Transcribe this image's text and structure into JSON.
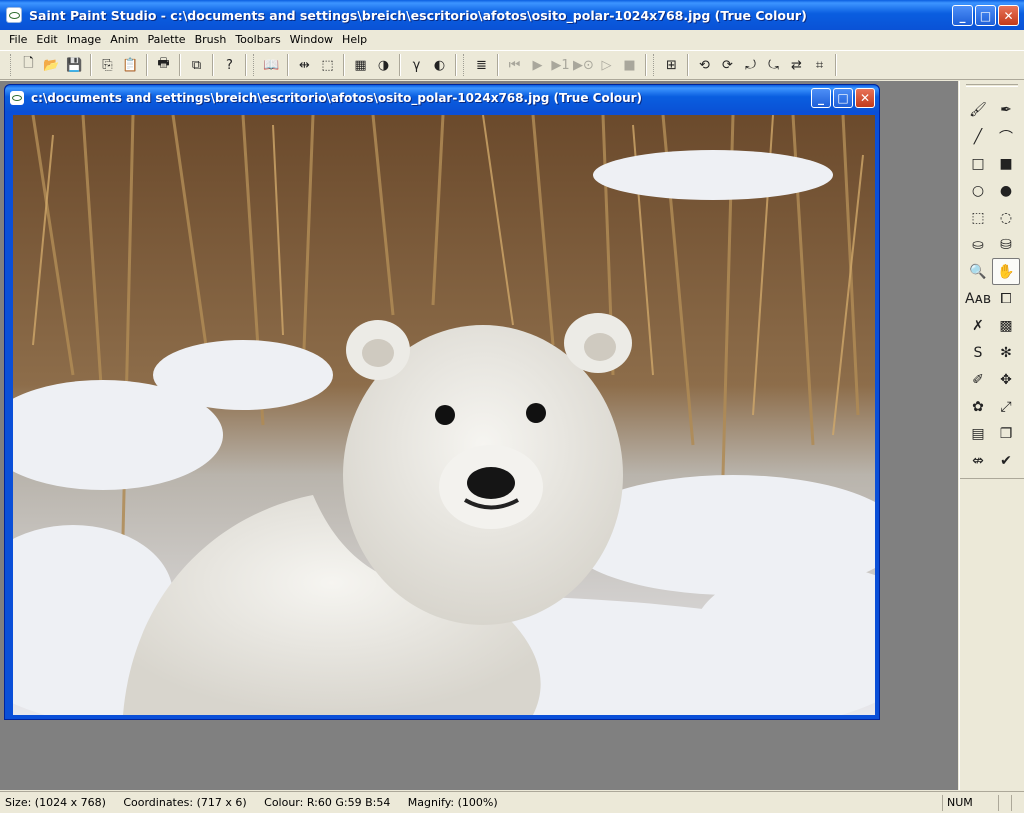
{
  "window": {
    "title": "Saint Paint Studio - c:\\documents and settings\\breich\\escritorio\\afotos\\osito_polar-1024x768.jpg (True Colour)",
    "buttons": {
      "minimize": "_",
      "maximize": "□",
      "close": "✕"
    }
  },
  "menu": [
    "File",
    "Edit",
    "Image",
    "Anim",
    "Palette",
    "Brush",
    "Toolbars",
    "Window",
    "Help"
  ],
  "toolbar": {
    "new": "🗋",
    "open": "📂",
    "save": "💾",
    "copy": "⎘",
    "paste": "📋",
    "print": "🖶",
    "duplicate": "⧉",
    "help": "?",
    "book": "📖",
    "resize": "⇹",
    "crop": "⬚",
    "palette": "▦",
    "contrast": "◑",
    "gamma": "γ",
    "invert": "◐",
    "stack": "≣",
    "anim_first": "⏮",
    "anim_play": "▶",
    "anim_step": "▶1",
    "anim_next": "▶⊙",
    "anim_loop": "▷",
    "anim_stop": "■",
    "view": "⊞",
    "rot_left": "⟲",
    "rot_right": "⟳",
    "rot_a": "⤾",
    "rot_b": "⤿",
    "flip": "⇄",
    "canvas": "⌗"
  },
  "document": {
    "title": "c:\\documents and settings\\breich\\escritorio\\afotos\\osito_polar-1024x768.jpg (True Colour)",
    "image_subject": "polar bear cub in snow"
  },
  "tools": [
    {
      "name": "brush",
      "glyph": "🖌"
    },
    {
      "name": "airbrush",
      "glyph": "✒"
    },
    {
      "name": "line",
      "glyph": "╱"
    },
    {
      "name": "curve",
      "glyph": "⌒"
    },
    {
      "name": "rect-outline",
      "glyph": "□"
    },
    {
      "name": "rect-fill",
      "glyph": "■"
    },
    {
      "name": "ellipse-outline",
      "glyph": "○"
    },
    {
      "name": "ellipse-fill",
      "glyph": "●"
    },
    {
      "name": "rect-select",
      "glyph": "⬚"
    },
    {
      "name": "lasso",
      "glyph": "◌"
    },
    {
      "name": "fill",
      "glyph": "⛀"
    },
    {
      "name": "spray",
      "glyph": "⛁"
    },
    {
      "name": "zoom",
      "glyph": "🔍"
    },
    {
      "name": "hand",
      "glyph": "✋"
    },
    {
      "name": "text",
      "glyph": "Aᴀʙ"
    },
    {
      "name": "clone",
      "glyph": "⧠"
    },
    {
      "name": "eraser",
      "glyph": "✗"
    },
    {
      "name": "stamp",
      "glyph": "▩"
    },
    {
      "name": "smudge",
      "glyph": "S"
    },
    {
      "name": "sparkle",
      "glyph": "✻"
    },
    {
      "name": "retouch",
      "glyph": "✐"
    },
    {
      "name": "move",
      "glyph": "✥"
    },
    {
      "name": "filter",
      "glyph": "✿"
    },
    {
      "name": "transform",
      "glyph": "⤢"
    },
    {
      "name": "film",
      "glyph": "▤"
    },
    {
      "name": "layers",
      "glyph": "❐"
    },
    {
      "name": "cancel",
      "glyph": "⇎"
    },
    {
      "name": "ok",
      "glyph": "✔"
    }
  ],
  "active_tool": "hand",
  "status": {
    "main": "Size: (1024 x 768)     Coordinates: (717 x 6)     Colour: R:60 G:59 B:54     Magnify: (100%)",
    "num": "NUM"
  },
  "colors": {
    "titlebar": "#0a5ee0",
    "workspace": "#808080",
    "chrome": "#ece9d8"
  }
}
